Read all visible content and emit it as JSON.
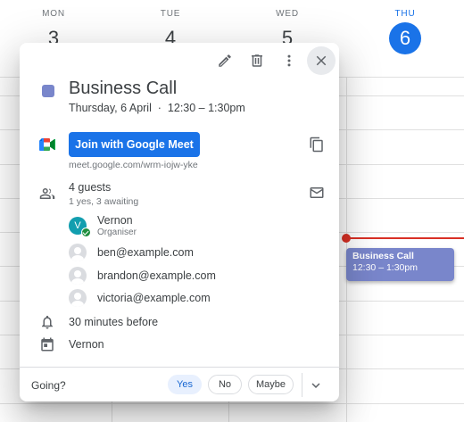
{
  "calendar": {
    "days": [
      {
        "name": "MON",
        "num": "3"
      },
      {
        "name": "TUE",
        "num": "4"
      },
      {
        "name": "WED",
        "num": "5"
      },
      {
        "name": "THU",
        "num": "6"
      }
    ],
    "event_chip": {
      "title": "Business Call",
      "time": "12:30 – 1:30pm"
    },
    "colors": {
      "today": "#1a73e8",
      "event": "#7986cb",
      "now_line": "#d93025"
    }
  },
  "popup": {
    "toolbar": {
      "edit_icon": "pencil-icon",
      "delete_icon": "trash-icon",
      "more_icon": "more-vert-icon",
      "close_icon": "close-icon"
    },
    "event": {
      "title": "Business Call",
      "when": "Thursday, 6 April  ·  12:30 – 1:30pm"
    },
    "meet": {
      "button_label": "Join with Google Meet",
      "url": "meet.google.com/wrm-iojw-yke"
    },
    "guests": {
      "count_label": "4 guests",
      "summary": "1 yes, 3 awaiting",
      "list": [
        {
          "name": "Vernon",
          "role": "Organiser",
          "initial": "V"
        },
        {
          "name": "ben@example.com"
        },
        {
          "name": "brandon@example.com"
        },
        {
          "name": "victoria@example.com"
        }
      ]
    },
    "reminder": "30 minutes before",
    "calendar_owner": "Vernon",
    "footer": {
      "prompt": "Going?",
      "yes": "Yes",
      "no": "No",
      "maybe": "Maybe",
      "selected": "Yes"
    }
  }
}
